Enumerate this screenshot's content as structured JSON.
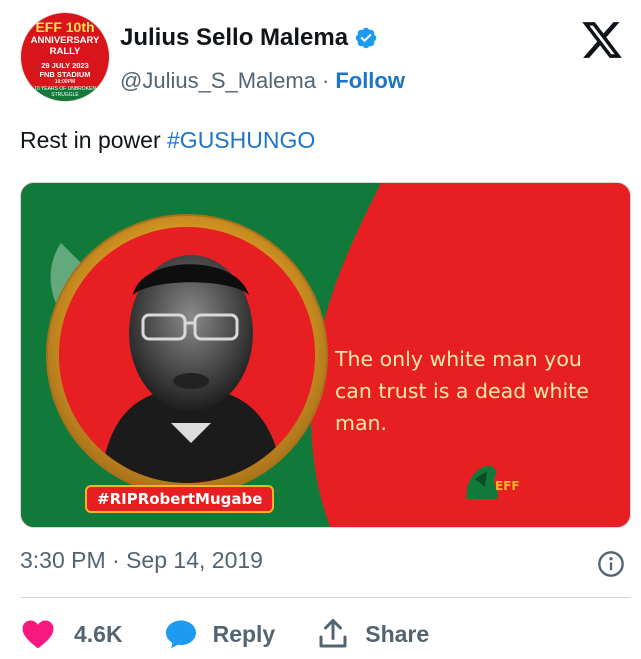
{
  "author": {
    "display_name": "Julius Sello Malema",
    "handle": "@Julius_S_Malema",
    "separator": "·",
    "follow_label": "Follow",
    "verified": true
  },
  "avatar": {
    "line1": "EFF 10th",
    "line2": "ANNIVERSARY",
    "line3": "RALLY",
    "line4": "29 JULY 2023",
    "line5": "FNB STADIUM",
    "line6": "10:00PM",
    "strip": "10 YEARS OF UNBROKEN STRUGGLE"
  },
  "tweet": {
    "text": "Rest in power ",
    "hashtag": "#GUSHUNGO"
  },
  "media": {
    "quote": "The only white man you can trust is a dead white man.",
    "tag": "#RIPRobertMugabe",
    "logo_text": "EFF"
  },
  "meta": {
    "timestamp": "3:30 PM · Sep 14, 2019"
  },
  "actions": {
    "likes": "4.6K",
    "reply": "Reply",
    "share": "Share"
  },
  "colors": {
    "accent": "#1d74c9",
    "like": "#f91880",
    "reply_icon": "#1d9bf0",
    "muted": "#536471",
    "eff_red": "#e81f22",
    "eff_green": "#117a3a",
    "gold": "#f2b52a"
  },
  "icons": [
    "verified-badge-icon",
    "x-logo-icon",
    "info-icon",
    "heart-icon",
    "reply-bubble-icon",
    "share-icon",
    "eff-logo-icon"
  ]
}
